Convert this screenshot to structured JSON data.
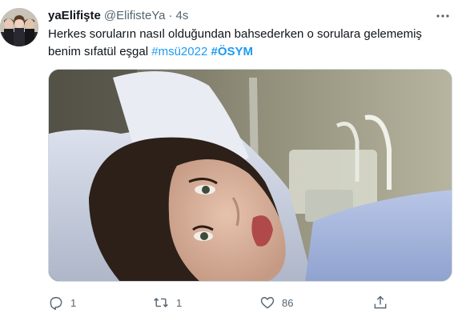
{
  "tweet": {
    "display_name": "yaElifişte",
    "handle": "@ElifisteYa",
    "separator": "·",
    "time": "4s",
    "text_main": "Herkes soruların nasıl olduğundan bahsederken o sorulara gelememiş benim sıfatül eşgal ",
    "hashtag_1": "#msü2022",
    "hashtag_2": "#ÖSYM",
    "media_icon": "photo"
  },
  "actions": {
    "reply_icon": "reply-icon",
    "reply_count": "1",
    "retweet_icon": "retweet-icon",
    "retweet_count": "1",
    "like_icon": "heart-icon",
    "like_count": "86",
    "share_icon": "share-icon"
  },
  "colors": {
    "link": "#1d9bf0",
    "muted": "#536471",
    "text": "#0f1419"
  }
}
